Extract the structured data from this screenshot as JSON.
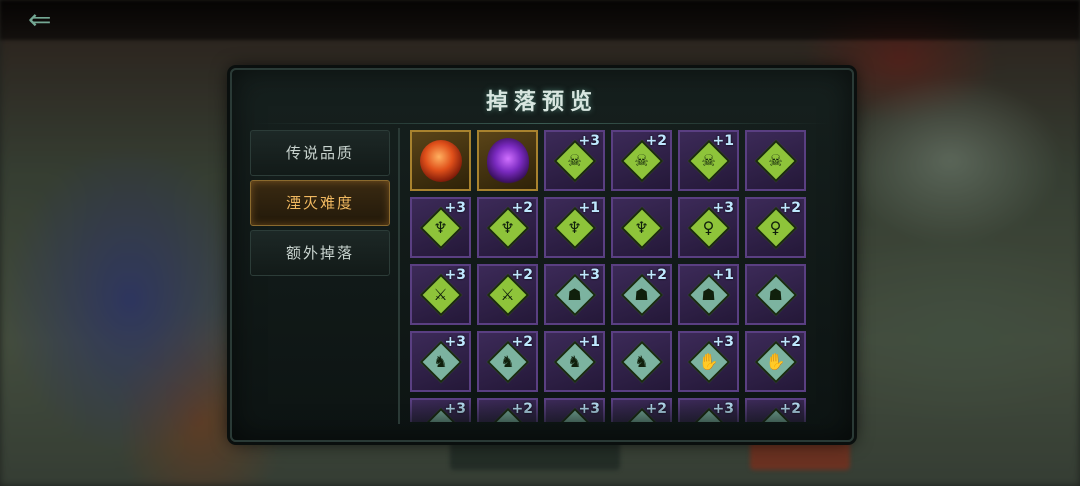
{
  "panel": {
    "title": "掉落预览"
  },
  "tabs": [
    {
      "label": "传说品质",
      "active": false
    },
    {
      "label": "湮灭难度",
      "active": true
    },
    {
      "label": "额外掉落",
      "active": false
    }
  ],
  "icons": {
    "back": "back-arrow-icon"
  },
  "colors": {
    "accent_active": "#f0b860",
    "cell_purple": "#3c2a58",
    "cell_gold": "#5a4418",
    "diamond_green": "#8ec43a",
    "diamond_teal": "#7cb3a0",
    "bonus_text": "#bfe8ff"
  },
  "grid": {
    "items": [
      {
        "kind": "gold",
        "art": "fire",
        "icon": "fire-orb-icon",
        "bonus": ""
      },
      {
        "kind": "gold",
        "art": "void",
        "icon": "void-mask-icon",
        "bonus": ""
      },
      {
        "kind": "purple",
        "art": "green",
        "icon": "skull-rune-icon",
        "bonus": "+3"
      },
      {
        "kind": "purple",
        "art": "green",
        "icon": "skull-rune-icon",
        "bonus": "+2"
      },
      {
        "kind": "purple",
        "art": "green",
        "icon": "skull-rune-icon",
        "bonus": "+1"
      },
      {
        "kind": "purple",
        "art": "green",
        "icon": "skull-rune-icon",
        "bonus": ""
      },
      {
        "kind": "purple",
        "art": "green",
        "icon": "horned-helm-rune-icon",
        "bonus": "+3"
      },
      {
        "kind": "purple",
        "art": "green",
        "icon": "horned-helm-rune-icon",
        "bonus": "+2"
      },
      {
        "kind": "purple",
        "art": "green",
        "icon": "horned-helm-rune-icon",
        "bonus": "+1"
      },
      {
        "kind": "purple",
        "art": "green",
        "icon": "horned-helm-rune-icon",
        "bonus": ""
      },
      {
        "kind": "purple",
        "art": "green",
        "icon": "figure-rune-icon",
        "bonus": "+3"
      },
      {
        "kind": "purple",
        "art": "green",
        "icon": "figure-rune-icon",
        "bonus": "+2"
      },
      {
        "kind": "purple",
        "art": "green",
        "icon": "weapon-rune-icon",
        "bonus": "+3"
      },
      {
        "kind": "purple",
        "art": "green",
        "icon": "weapon-rune-icon",
        "bonus": "+2"
      },
      {
        "kind": "purple",
        "art": "teal",
        "icon": "mask-rune-icon",
        "bonus": "+3"
      },
      {
        "kind": "purple",
        "art": "teal",
        "icon": "mask-rune-icon",
        "bonus": "+2"
      },
      {
        "kind": "purple",
        "art": "teal",
        "icon": "mask-rune-icon",
        "bonus": "+1"
      },
      {
        "kind": "purple",
        "art": "teal",
        "icon": "mask-rune-icon",
        "bonus": ""
      },
      {
        "kind": "purple",
        "art": "teal",
        "icon": "beast-rune-icon",
        "bonus": "+3"
      },
      {
        "kind": "purple",
        "art": "teal",
        "icon": "beast-rune-icon",
        "bonus": "+2"
      },
      {
        "kind": "purple",
        "art": "teal",
        "icon": "beast-rune-icon",
        "bonus": "+1"
      },
      {
        "kind": "purple",
        "art": "teal",
        "icon": "beast-rune-icon",
        "bonus": ""
      },
      {
        "kind": "purple",
        "art": "teal",
        "icon": "claw-rune-icon",
        "bonus": "+3"
      },
      {
        "kind": "purple",
        "art": "teal",
        "icon": "claw-rune-icon",
        "bonus": "+2"
      },
      {
        "kind": "purple",
        "art": "teal",
        "icon": "rune-icon",
        "bonus": "+3"
      },
      {
        "kind": "purple",
        "art": "teal",
        "icon": "rune-icon",
        "bonus": "+2"
      },
      {
        "kind": "purple",
        "art": "teal",
        "icon": "rune-icon",
        "bonus": "+3"
      },
      {
        "kind": "purple",
        "art": "teal",
        "icon": "rune-icon",
        "bonus": "+2"
      },
      {
        "kind": "purple",
        "art": "teal",
        "icon": "rune-icon",
        "bonus": "+3"
      },
      {
        "kind": "purple",
        "art": "teal",
        "icon": "rune-icon",
        "bonus": "+2"
      }
    ]
  }
}
